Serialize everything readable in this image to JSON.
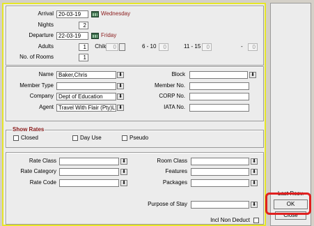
{
  "stay": {
    "arrival_label": "Arrival",
    "arrival_value": "20-03-19",
    "arrival_day": "Wednesday",
    "nights_label": "Nights",
    "nights_value": "2",
    "departure_label": "Departure",
    "departure_value": "22-03-19",
    "departure_day": "Friday",
    "adults_label": "Adults",
    "adults_value": "1",
    "children_label": "Children",
    "children_value": "0",
    "age_6_10_label": "6 - 10",
    "age_6_10_value": "0",
    "age_11_15_label": "11 - 15",
    "age_11_15_value": "0",
    "age_extra_label": "-",
    "age_extra_value": "0",
    "rooms_label": "No. of Rooms",
    "rooms_value": "1"
  },
  "profiles": {
    "name_label": "Name",
    "name_value": "Baker,Chris",
    "member_type_label": "Member Type",
    "member_type_value": "",
    "company_label": "Company",
    "company_value": "Dept of Education",
    "agent_label": "Agent",
    "agent_value": "Travel With Flair (Pty)Ltd",
    "block_label": "Block",
    "block_value": "",
    "member_no_label": "Member No.",
    "member_no_value": "",
    "corp_no_label": "CORP No.",
    "corp_no_value": "",
    "iata_no_label": "IATA No.",
    "iata_no_value": ""
  },
  "show_rates": {
    "title": "Show Rates",
    "closed_label": "Closed",
    "day_use_label": "Day Use",
    "pseudo_label": "Pseudo"
  },
  "rates": {
    "rate_class_label": "Rate Class",
    "rate_category_label": "Rate Category",
    "rate_code_label": "Rate Code",
    "room_class_label": "Room Class",
    "features_label": "Features",
    "packages_label": "Packages",
    "purpose_label": "Purpose of Stay",
    "incl_non_deduct_label": "Incl Non Deduct"
  },
  "buttons": {
    "last_resv": "Last Resv.",
    "ok": "OK",
    "close": "Close"
  },
  "colors": {
    "panel_border": "#e6e627",
    "highlight": "#e02020",
    "day_text": "#8a1a1a"
  }
}
